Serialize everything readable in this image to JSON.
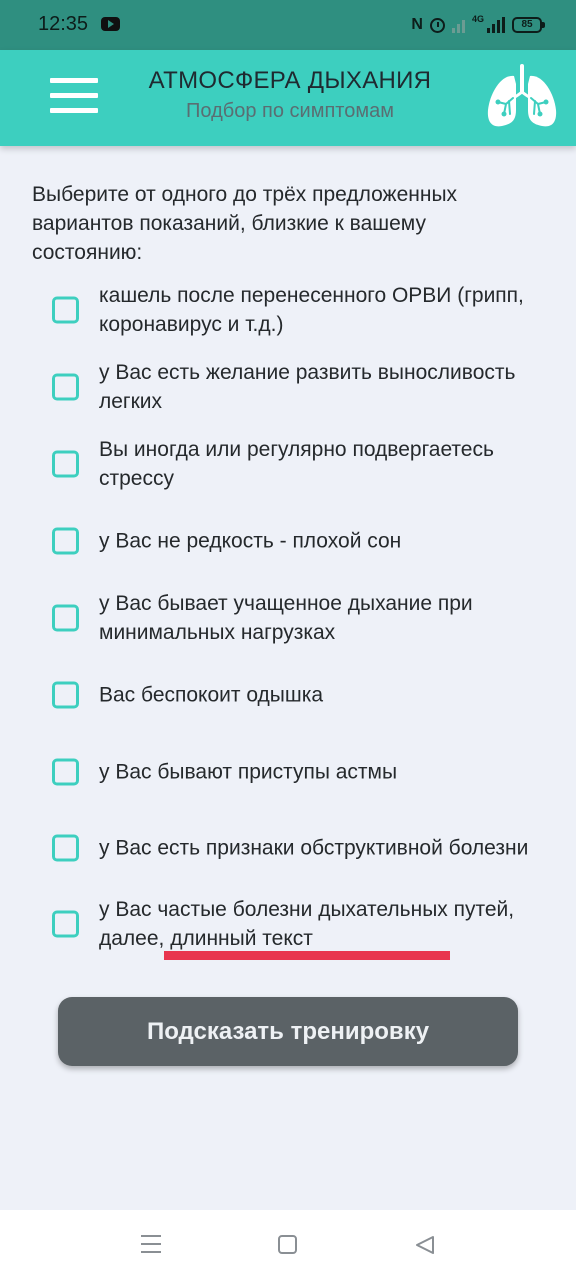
{
  "status_bar": {
    "time": "12:35",
    "network": "4G",
    "battery": "85",
    "icons": [
      "youtube-icon",
      "nfc-icon",
      "alarm-icon",
      "signal-icon",
      "battery-icon"
    ]
  },
  "app_bar": {
    "title": "АТМОСФЕРА ДЫХАНИЯ",
    "subtitle": "Подбор по симптомам",
    "menu_icon": "hamburger-menu-icon",
    "logo_icon": "lungs-icon"
  },
  "intro": "Выберите от одного до трёх предложенных вариантов показаний, близкие к вашему состоянию:",
  "options": [
    {
      "label": "кашель после перенесенного ОРВИ (грипп, коронавирус и т.д.)",
      "checked": false
    },
    {
      "label": "у Вас есть желание развить выносливость легких",
      "checked": false
    },
    {
      "label": "Вы иногда или регулярно подвергаетесь стрессу",
      "checked": false
    },
    {
      "label": "у Вас не редкость - плохой сон",
      "checked": false
    },
    {
      "label": "у Вас бывает учащенное дыхание при минимальных нагрузках",
      "checked": false
    },
    {
      "label": "Вас беспокоит одышка",
      "checked": false
    },
    {
      "label": "у Вас бывают приступы астмы",
      "checked": false
    },
    {
      "label": "у Вас есть признаки обструктивной болезни",
      "checked": false
    },
    {
      "label": "у Вас частые болезни дыхательных путей, далее, длинный текст",
      "checked": false
    }
  ],
  "submit_label": "Подсказать тренировку",
  "colors": {
    "status_bar": "#2f8f80",
    "app_bar": "#3dcfbf",
    "checkbox_border": "#3dcfbf",
    "button": "#5b6266",
    "background": "#eef1f8",
    "annotation_underline": "#e8364f"
  },
  "nav_bar": {
    "icons": [
      "recent-apps-icon",
      "home-icon",
      "back-icon"
    ]
  }
}
